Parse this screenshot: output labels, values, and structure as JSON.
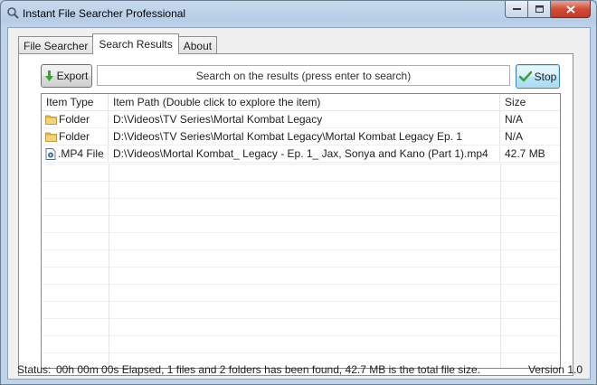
{
  "window": {
    "title": "Instant File Searcher Professional"
  },
  "tabs": [
    {
      "label": "File Searcher"
    },
    {
      "label": "Search Results"
    },
    {
      "label": "About"
    }
  ],
  "toolbar": {
    "export_label": "Export",
    "search_placeholder": "Search on the results (press enter to search)",
    "stop_label": "Stop"
  },
  "table": {
    "columns": [
      "Item Type",
      "Item Path (Double click to explore the item)",
      "Size"
    ],
    "rows": [
      {
        "icon": "folder-icon",
        "type": "Folder",
        "path": "D:\\Videos\\TV Series\\Mortal Kombat Legacy",
        "size": "N/A"
      },
      {
        "icon": "folder-icon",
        "type": "Folder",
        "path": "D:\\Videos\\TV Series\\Mortal Kombat Legacy\\Mortal Kombat Legacy Ep. 1",
        "size": "N/A"
      },
      {
        "icon": "video-file-icon",
        "type": ".MP4 File",
        "path": "D:\\Videos\\Mortal Kombat_ Legacy - Ep. 1_ Jax, Sonya and Kano (Part 1).mp4",
        "size": "42.7 MB"
      }
    ]
  },
  "status": {
    "label": "Status:",
    "text": "00h 00m 00s Elapsed, 1 files and 2 folders has been found, 42.7 MB is the total file size.",
    "version": "Version 1.0"
  },
  "colors": {
    "titlebar": "#b9d1ea",
    "close_button": "#c9432d",
    "export_arrow": "#3aa335",
    "stop_check": "#3aa335",
    "folder": "#e8b84a"
  }
}
